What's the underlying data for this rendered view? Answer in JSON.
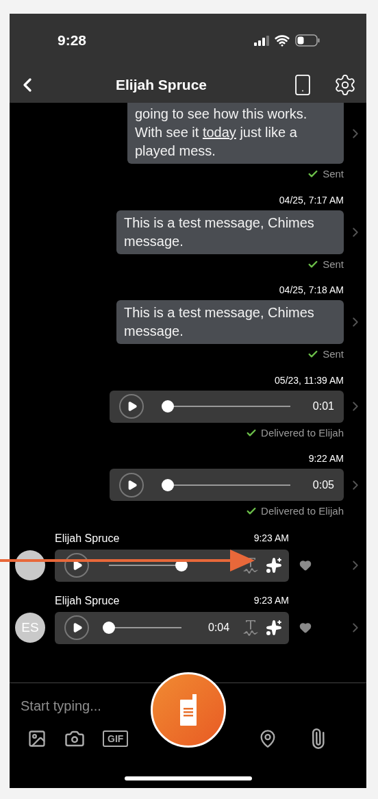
{
  "status_bar": {
    "time": "9:28"
  },
  "header": {
    "title": "Elijah Spruce"
  },
  "messages": [
    {
      "kind": "text",
      "incoming": false,
      "segments": [
        {
          "text": "going to see how this works. With see it ",
          "link": false
        },
        {
          "text": "today",
          "link": true
        },
        {
          "text": " just like a played mess.",
          "link": false
        }
      ],
      "status": "Sent"
    },
    {
      "kind": "text",
      "incoming": false,
      "time": "04/25, 7:17 AM",
      "segments": [
        {
          "text": "This is a test message, Chimes message.",
          "link": false
        }
      ],
      "status": "Sent"
    },
    {
      "kind": "text",
      "incoming": false,
      "time": "04/25, 7:18 AM",
      "segments": [
        {
          "text": "This is a test message, Chimes message.",
          "link": false
        }
      ],
      "status": "Sent"
    },
    {
      "kind": "voice",
      "incoming": false,
      "time": "05/23, 11:39 AM",
      "duration": "0:01",
      "level": 0,
      "status": "Delivered to Elijah"
    },
    {
      "kind": "voice",
      "incoming": false,
      "time": "9:22 AM",
      "duration": "0:05",
      "level": 0,
      "status": "Delivered to Elijah"
    },
    {
      "kind": "voice",
      "incoming": true,
      "sender": "Elijah Spruce",
      "time": "9:23 AM",
      "level": 1
    },
    {
      "kind": "voice",
      "incoming": true,
      "sender": "Elijah Spruce",
      "avatar": "ES",
      "time": "9:23 AM",
      "duration": "0:04",
      "level": 0
    }
  ],
  "composer": {
    "placeholder": "Start typing...",
    "gif": "GIF"
  }
}
